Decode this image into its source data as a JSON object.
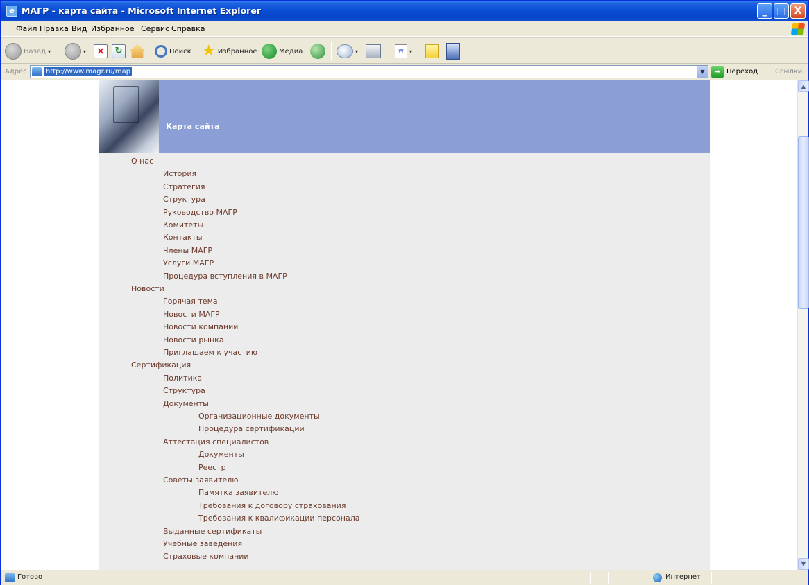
{
  "window": {
    "title": "МАГР - карта сайта - Microsoft Internet Explorer",
    "controls": {
      "minimize": "_",
      "maximize": "□",
      "close": "X"
    }
  },
  "menu": {
    "items": [
      "Файл",
      "Правка",
      "Вид",
      "Избранное",
      "Сервис",
      "Справка"
    ]
  },
  "toolbar": {
    "back_label": "Назад",
    "search_label": "Поиск",
    "favorites_label": "Избранное",
    "media_label": "Медиа"
  },
  "address": {
    "label": "Адрес",
    "url": "http://www.magr.ru/map",
    "go_label": "Переход",
    "links_label": "Ссылки"
  },
  "page": {
    "banner_title": "Карта сайта",
    "sitemap": [
      {
        "label": "О нас",
        "level": 0
      },
      {
        "label": "История",
        "level": 1
      },
      {
        "label": "Стратегия",
        "level": 1
      },
      {
        "label": "Структура",
        "level": 1
      },
      {
        "label": "Руководство МАГР",
        "level": 1
      },
      {
        "label": "Комитеты",
        "level": 1
      },
      {
        "label": "Контакты",
        "level": 1
      },
      {
        "label": "Члены МАГР",
        "level": 1
      },
      {
        "label": "Услуги МАГР",
        "level": 1
      },
      {
        "label": "Процедура вступления в МАГР",
        "level": 1
      },
      {
        "label": "Новости",
        "level": 0
      },
      {
        "label": "Горячая тема",
        "level": 1
      },
      {
        "label": "Новости МАГР",
        "level": 1
      },
      {
        "label": "Новости компаний",
        "level": 1
      },
      {
        "label": "Новости рынка",
        "level": 1
      },
      {
        "label": "Приглашаем к участию",
        "level": 1
      },
      {
        "label": "Сертификация",
        "level": 0
      },
      {
        "label": "Политика",
        "level": 1
      },
      {
        "label": "Структура",
        "level": 1
      },
      {
        "label": "Документы",
        "level": 1
      },
      {
        "label": "Организационные документы",
        "level": 2
      },
      {
        "label": "Процедура сертификации",
        "level": 2
      },
      {
        "label": "Аттестация специалистов",
        "level": 1
      },
      {
        "label": "Документы",
        "level": 2
      },
      {
        "label": "Реестр",
        "level": 2
      },
      {
        "label": "Советы заявителю",
        "level": 1
      },
      {
        "label": "Памятка заявителю",
        "level": 2
      },
      {
        "label": "Требования к договору страхования",
        "level": 2
      },
      {
        "label": "Требования к квалификации персонала",
        "level": 2
      },
      {
        "label": "Выданные сертификаты",
        "level": 1
      },
      {
        "label": "Учебные заведения",
        "level": 1
      },
      {
        "label": "Страховые компании",
        "level": 1
      }
    ]
  },
  "status": {
    "text": "Готово",
    "zone": "Интернет"
  }
}
